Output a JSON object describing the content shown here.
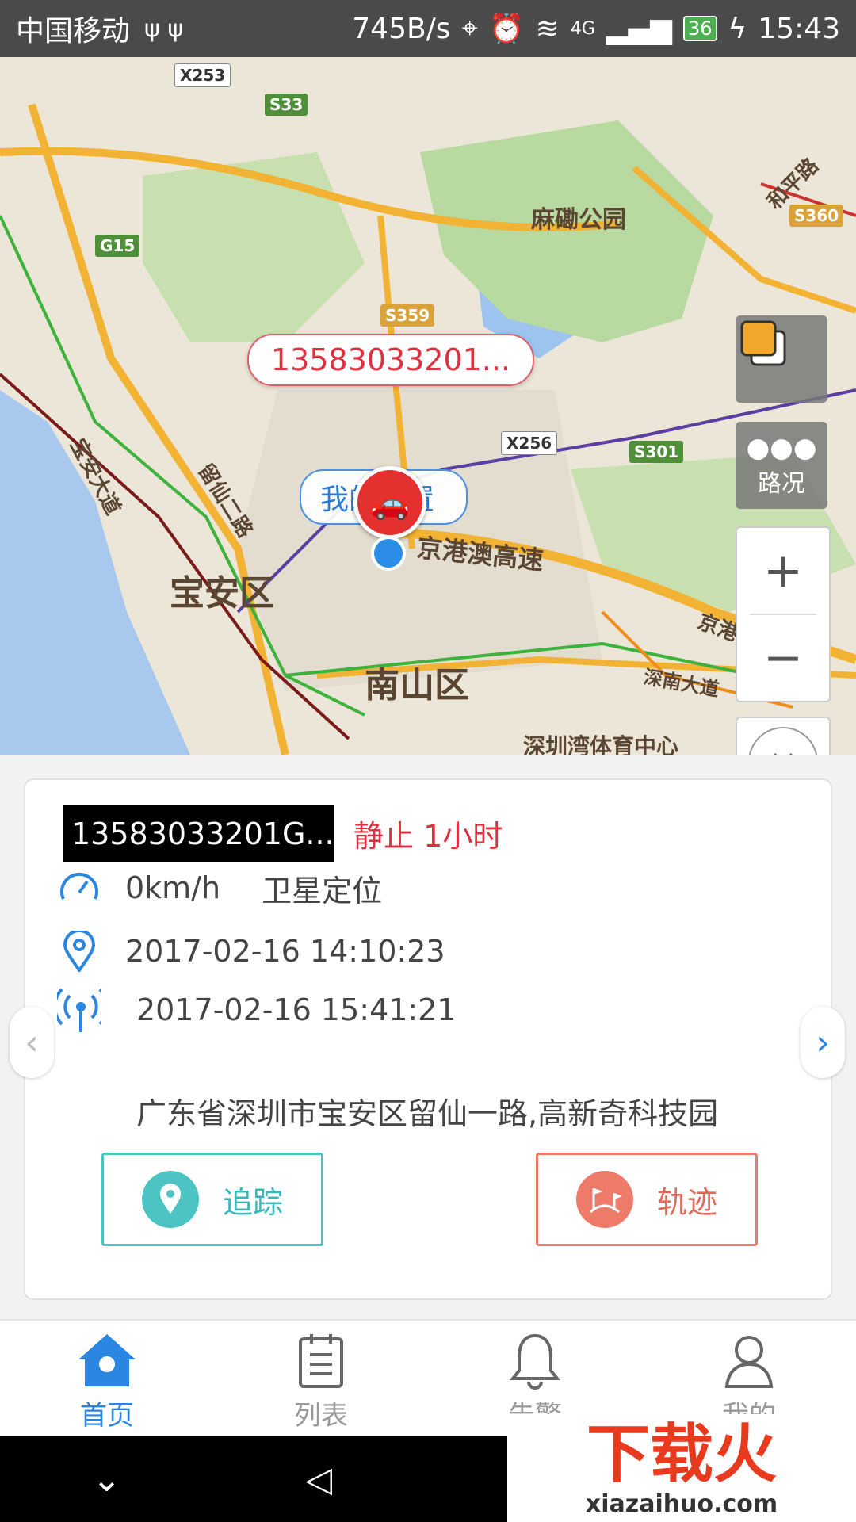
{
  "status_bar": {
    "carrier": "中国移动",
    "usb": "ψ ψ",
    "speed": "745B/s",
    "network": "4G",
    "battery": "36",
    "time": "15:43"
  },
  "map": {
    "labels": {
      "park": "麻磡公园",
      "baoan": "宝安区",
      "nanshan": "南山区",
      "expressway": "京港澳高速",
      "baoan_avenue": "宝安大道",
      "road_liuxian": "留仙二路",
      "heping": "和平路",
      "shennan": "深南大道",
      "jingji": "京港澳",
      "stadium": "深圳湾体育中心"
    },
    "shields": {
      "x253": "X253",
      "s33": "S33",
      "g15": "G15",
      "s359": "S359",
      "x256": "X256",
      "s301": "S301",
      "s360": "S360"
    },
    "callout": "13583033201...",
    "my_position": "我的位置",
    "traffic_label": "路况",
    "zoom_in": "+",
    "zoom_out": "−",
    "close": "×",
    "collapse": "︿"
  },
  "device": {
    "plate": "13583033201G...",
    "status": "静止 1小时",
    "speed": "0km/h",
    "locate_mode": "卫星定位",
    "gps_time": "2017-02-16 14:10:23",
    "signal_time": "2017-02-16 15:41:21",
    "address": "广东省深圳市宝安区留仙一路,高新奇科技园",
    "track_btn": "追踪",
    "trail_btn": "轨迹"
  },
  "tabs": [
    {
      "label": "首页",
      "icon": "home-icon",
      "active": true
    },
    {
      "label": "列表",
      "icon": "list-icon",
      "active": false
    },
    {
      "label": "告警",
      "icon": "bell-icon",
      "active": false
    },
    {
      "label": "我的",
      "icon": "user-icon",
      "active": false
    }
  ],
  "watermark": {
    "main": "下载火",
    "sub": "xiazaihuo.com"
  },
  "colors": {
    "accent": "#2a86e0",
    "alert": "#e03040",
    "teal": "#4cc4c4",
    "coral": "#ee7a6a"
  }
}
